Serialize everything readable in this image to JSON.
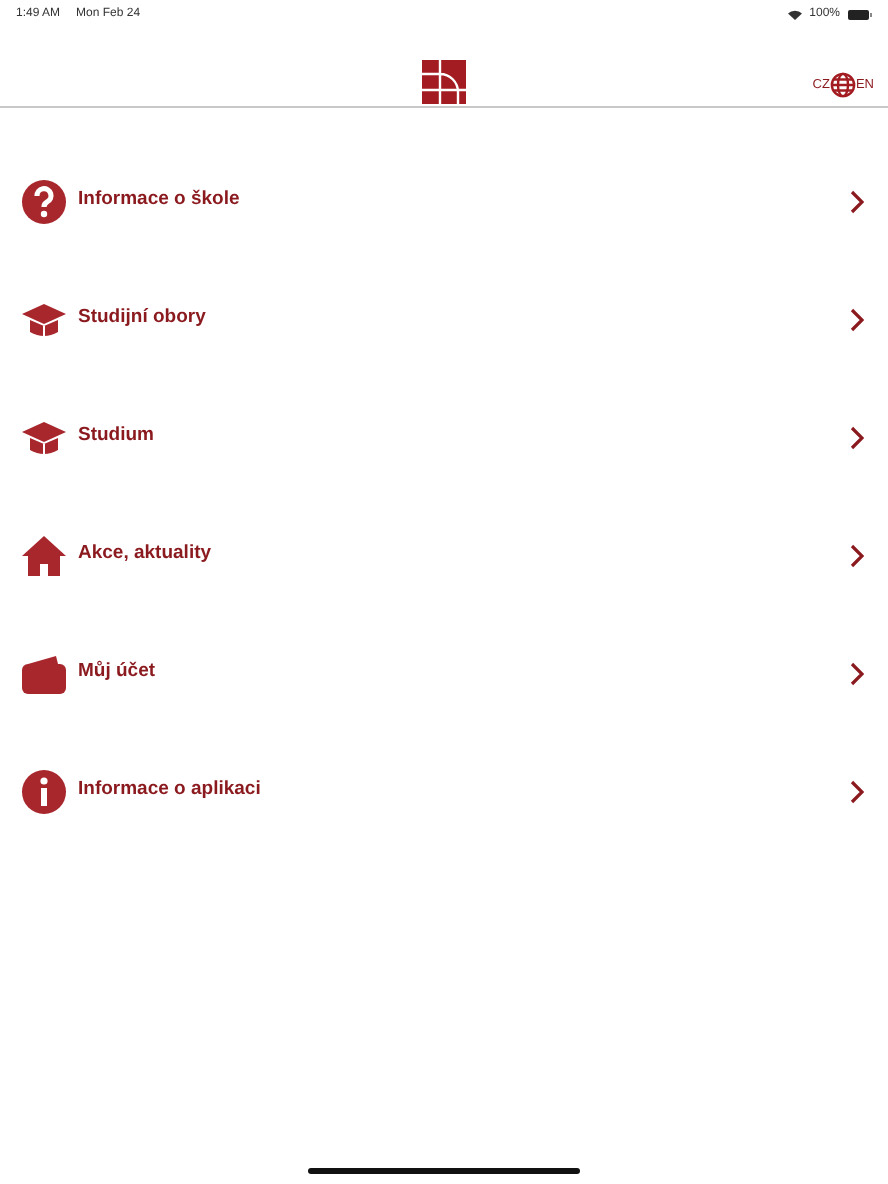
{
  "status_bar": {
    "time": "1:49 AM",
    "date": "Mon Feb 24",
    "battery": "100%"
  },
  "header": {
    "language": {
      "left": "CZ",
      "right": "EN"
    }
  },
  "menu": [
    {
      "kind": "question",
      "label": "Informace o škole"
    },
    {
      "kind": "cap",
      "label": "Studijní obory"
    },
    {
      "kind": "cap",
      "label": "Studium"
    },
    {
      "kind": "home",
      "label": "Akce, aktuality"
    },
    {
      "kind": "wallet",
      "label": "Můj účet"
    },
    {
      "kind": "info",
      "label": "Informace o aplikaci"
    }
  ]
}
